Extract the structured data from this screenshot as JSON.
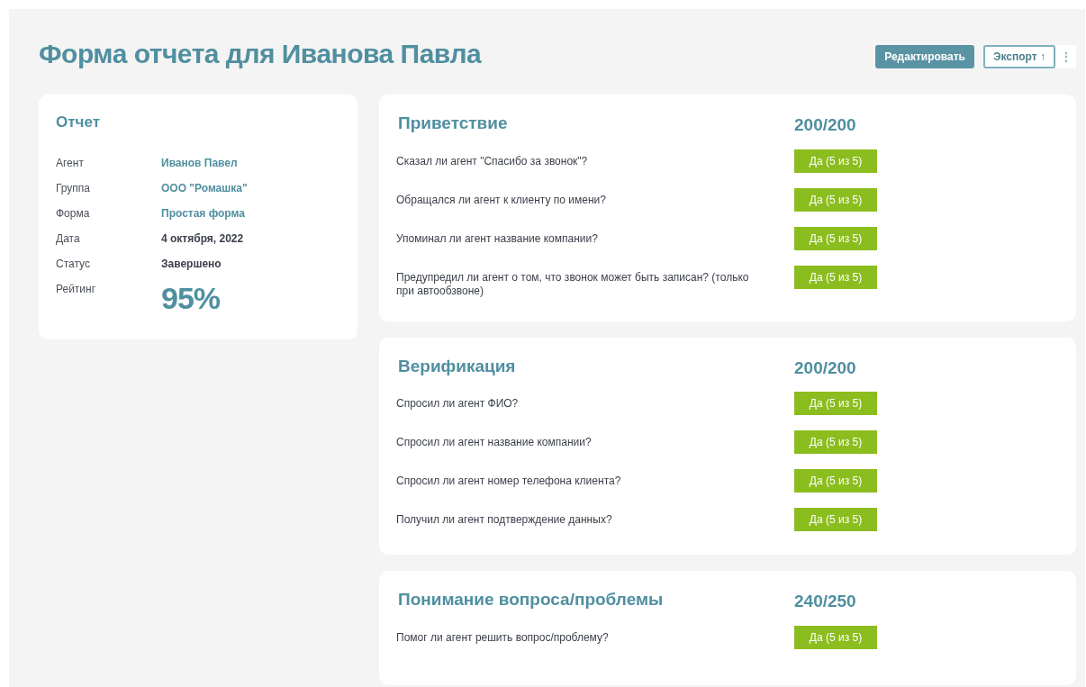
{
  "title": "Форма отчета для Иванова Павла",
  "actions": [
    {
      "label": "Редактировать",
      "kind": "primary"
    },
    {
      "label": "Экспорт ↑",
      "kind": "outline"
    },
    {
      "label": "⋮",
      "kind": "menu"
    }
  ],
  "report": {
    "title": "Отчет",
    "fields": [
      {
        "label": "Агент",
        "value": "Иванов Павел",
        "kind": "link"
      },
      {
        "label": "Группа",
        "value": "ООО \"Ромашка\"",
        "kind": "link"
      },
      {
        "label": "Форма",
        "value": "Простая форма",
        "kind": "link"
      },
      {
        "label": "Дата",
        "value": "4 октября, 2022",
        "kind": "text"
      },
      {
        "label": "Статус",
        "value": "Завершено",
        "kind": "text"
      },
      {
        "label": "Рейтинг",
        "value": "95%",
        "kind": "rating"
      }
    ]
  },
  "sections": [
    {
      "title": "Приветствие",
      "score": "200/200",
      "questions": [
        {
          "text": "Сказал ли агент \"Спасибо за звонок\"?",
          "answer": "Да (5 из 5)"
        },
        {
          "text": "Обращался ли агент к клиенту по имени?",
          "answer": "Да (5 из 5)"
        },
        {
          "text": "Упоминал ли агент название компании?",
          "answer": "Да (5 из 5)"
        },
        {
          "text": "Предупредил ли агент о том, что звонок может быть записан? (только при автообзвоне)",
          "answer": "Да (5 из 5)"
        }
      ]
    },
    {
      "title": "Верификация",
      "score": "200/200",
      "questions": [
        {
          "text": "Спросил ли агент ФИО?",
          "answer": "Да (5 из 5)"
        },
        {
          "text": "Спросил ли агент название компании?",
          "answer": "Да (5 из 5)"
        },
        {
          "text": "Спросил ли агент номер телефона клиента?",
          "answer": "Да (5 из 5)"
        },
        {
          "text": "Получил ли агент подтверждение данных?",
          "answer": "Да (5 из 5)"
        }
      ]
    },
    {
      "title": "Понимание вопроса/проблемы",
      "score": "240/250",
      "questions": [
        {
          "text": "Помог ли агент решить вопрос/проблему?",
          "answer": "Да (5 из 5)"
        }
      ]
    }
  ]
}
